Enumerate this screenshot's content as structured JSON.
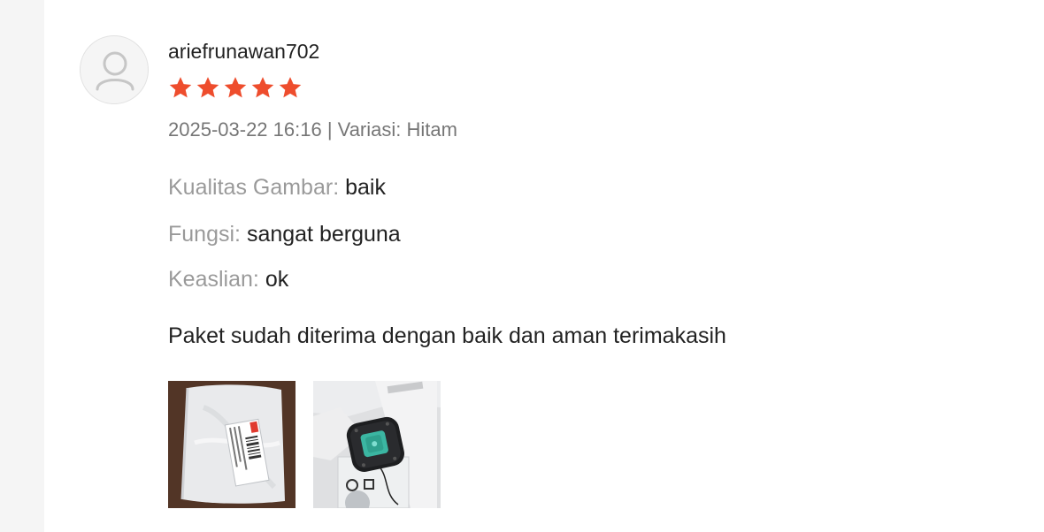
{
  "review": {
    "username": "ariefrunawan702",
    "rating": 5,
    "rating_max": 5,
    "star_color": "#ee4d2d",
    "timestamp": "2025-03-22 16:16",
    "separator": " | ",
    "variation_label": "Variasi:",
    "variation_value": "Hitam",
    "attributes": [
      {
        "label": "Kualitas Gambar:",
        "value": "baik"
      },
      {
        "label": "Fungsi:",
        "value": "sangat berguna"
      },
      {
        "label": "Keaslian:",
        "value": "ok"
      }
    ],
    "comment": "Paket sudah diterima dengan baik dan aman terimakasih",
    "media": [
      {
        "icon": "package-photo"
      },
      {
        "icon": "camera-detector-photo"
      }
    ]
  }
}
